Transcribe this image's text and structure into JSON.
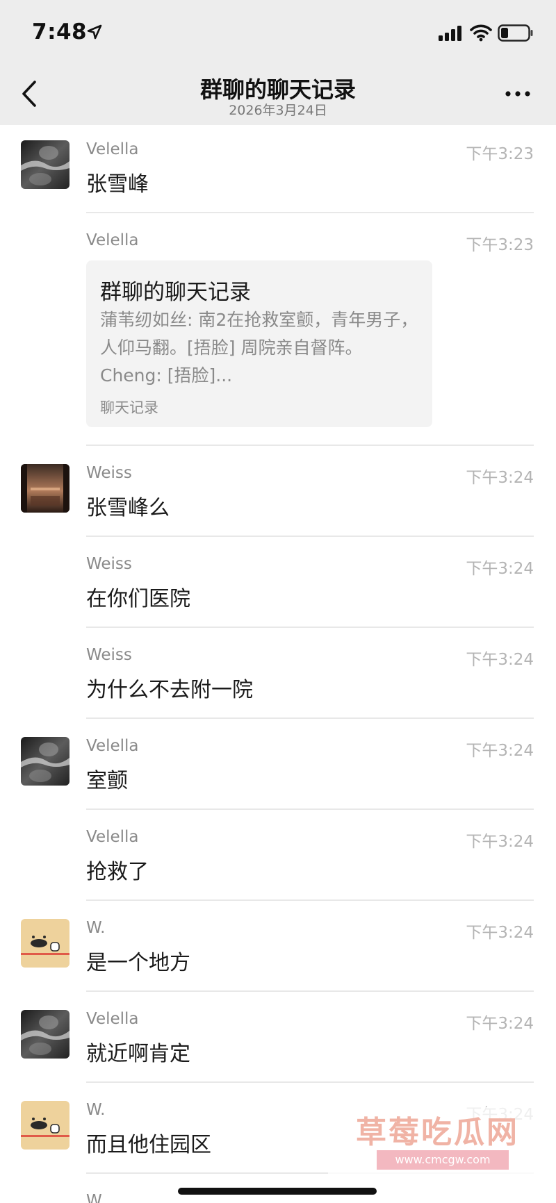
{
  "status_bar": {
    "time": "7:48",
    "icons": [
      "location-arrow-icon",
      "signal-icon",
      "wifi-icon",
      "battery-icon"
    ]
  },
  "header": {
    "title": "群聊的聊天记录",
    "subtitle": "2026年3月24日",
    "icons": [
      "back-chevron-icon",
      "more-icon"
    ]
  },
  "messages": [
    {
      "sender": "Velella",
      "time": "下午3:23",
      "text": "张雪峰",
      "avatar": "velella"
    },
    {
      "sender": "Velella",
      "time": "下午3:23",
      "card": {
        "title": "群聊的聊天记录",
        "preview": "蒲苇纫如丝: 南2在抢救室颤，青年男子，人仰马翻。[捂脸] 周院亲自督阵。Cheng: [捂脸]...",
        "label": "聊天记录"
      }
    },
    {
      "sender": "Weiss",
      "time": "下午3:24",
      "text": "张雪峰么",
      "avatar": "weiss"
    },
    {
      "sender": "Weiss",
      "time": "下午3:24",
      "text": "在你们医院"
    },
    {
      "sender": "Weiss",
      "time": "下午3:24",
      "text": "为什么不去附一院"
    },
    {
      "sender": "Velella",
      "time": "下午3:24",
      "text": "室颤",
      "avatar": "velella"
    },
    {
      "sender": "Velella",
      "time": "下午3:24",
      "text": "抢救了"
    },
    {
      "sender": "W.",
      "time": "下午3:24",
      "text": "是一个地方",
      "avatar": "w"
    },
    {
      "sender": "Velella",
      "time": "下午3:24",
      "text": "就近啊肯定",
      "avatar": "velella"
    },
    {
      "sender": "W.",
      "time": "下午3:24",
      "text": "而且他住园区",
      "avatar": "w"
    },
    {
      "sender": "W."
    }
  ],
  "watermark": {
    "text": "草莓吃瓜网",
    "url": "www.cmcgw.com"
  },
  "colors": {
    "bar_background": "#ededed",
    "sender_gray": "#8a8a8a",
    "time_gray": "#b4b4b4",
    "card_background": "#f3f3f3",
    "watermark_text": "#f0b3a5"
  }
}
